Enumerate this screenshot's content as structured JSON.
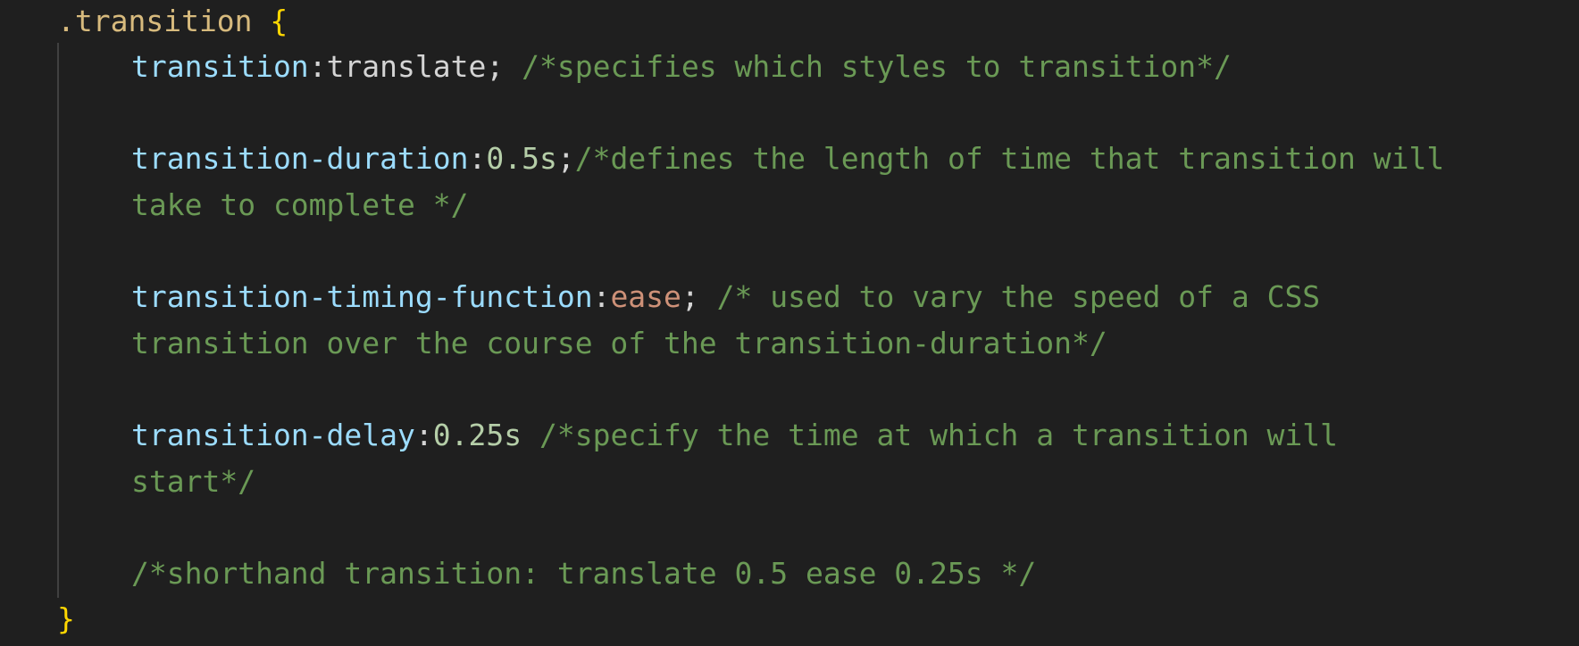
{
  "colors": {
    "background": "#1f1f1f",
    "selector": "#d7ba7d",
    "brace": "#ffd700",
    "property": "#9cdcfe",
    "plain": "#d4d4d4",
    "number": "#b5cea8",
    "keyword_value": "#ce9178",
    "comment": "#6a9955",
    "indent_guide": "#404040"
  },
  "code": {
    "line1": {
      "selector": ".transition",
      "space": " ",
      "open_brace": "{"
    },
    "line2": {
      "prop": "transition",
      "colon": ":",
      "value": "translate;",
      "space": " ",
      "comment": "/*specifies which styles to transition*/"
    },
    "line3": {
      "prop": "transition-duration",
      "colon": ":",
      "value": "0.5s",
      "semi": ";",
      "comment": "/*defines the length of time that transition will"
    },
    "line4": {
      "comment": "take to complete */"
    },
    "line5": {
      "prop": "transition-timing-function",
      "colon": ":",
      "value": "ease",
      "semi": ";",
      "space": " ",
      "comment": "/* used to vary the speed of a CSS"
    },
    "line6": {
      "comment": "transition over the course of the transition-duration*/"
    },
    "line7": {
      "prop": "transition-delay",
      "colon": ":",
      "value": "0.25s",
      "space": " ",
      "comment": "/*specify the time at which a transition will"
    },
    "line8": {
      "comment": "start*/"
    },
    "line9": {
      "comment": "/*shorthand transition: translate 0.5 ease 0.25s */"
    },
    "line10": {
      "close_brace": "}"
    }
  }
}
